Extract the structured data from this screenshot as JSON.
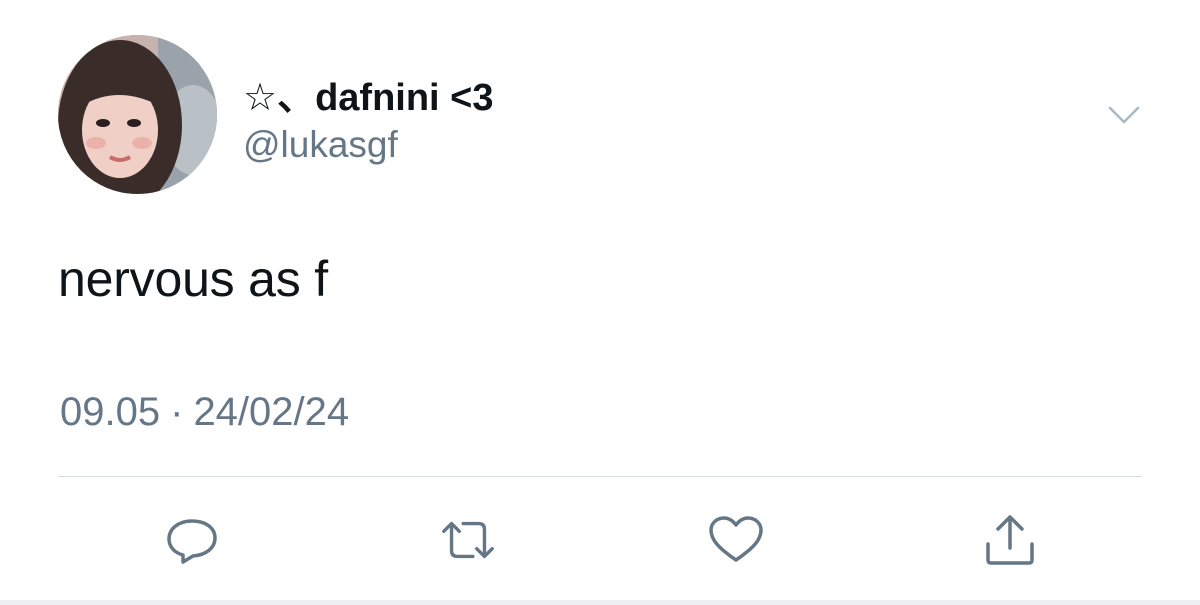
{
  "author": {
    "display_name": "☆、dafnini <3",
    "handle": "@lukasgf"
  },
  "tweet": {
    "text": "nervous as f",
    "time": "09.05",
    "separator": "·",
    "date": "24/02/24"
  },
  "icons": {
    "menu": "chevron-down-icon",
    "reply": "reply-icon",
    "retweet": "retweet-icon",
    "like": "heart-icon",
    "share": "share-icon"
  },
  "colors": {
    "text_primary": "#0f1419",
    "text_secondary": "#657786",
    "icon": "#657786",
    "divider": "#d6dde3"
  }
}
